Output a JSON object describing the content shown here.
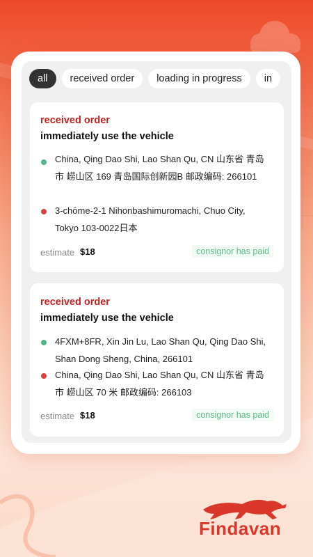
{
  "tabs": [
    "all",
    "received order",
    "loading in progress",
    "in"
  ],
  "active_tab": 0,
  "orders": [
    {
      "status": "received order",
      "title": "immediately use the vehicle",
      "origin": "China, Qing Dao Shi, Lao Shan Qu, CN 山东省 青岛市 崂山区 169 青岛国际创新园B 邮政编码: 266101",
      "destination": "3-chōme-2-1 Nihonbashimuromachi, Chuo City, Tokyo 103-0022日本",
      "estimate_label": "estimate",
      "estimate_value": "$18",
      "payment_status": "consignor has paid"
    },
    {
      "status": "received order",
      "title": "immediately use the vehicle",
      "origin": "4FXM+8FR, Xin Jin Lu, Lao Shan Qu, Qing Dao Shi, Shan Dong Sheng, China, 266101",
      "destination": "China, Qing Dao Shi, Lao Shan Qu, CN 山东省 青岛市 崂山区 70 米 邮政编码: 266103",
      "estimate_label": "estimate",
      "estimate_value": "$18",
      "payment_status": "consignor has paid"
    }
  ],
  "brand": {
    "name": "Findavan",
    "logo_icon": "running-cheetah-icon"
  },
  "colors": {
    "accent": "#d9372a",
    "status_red": "#c62020",
    "paid_green": "#5cbb8a",
    "origin_dot": "#52b788",
    "destination_dot": "#d94040"
  }
}
